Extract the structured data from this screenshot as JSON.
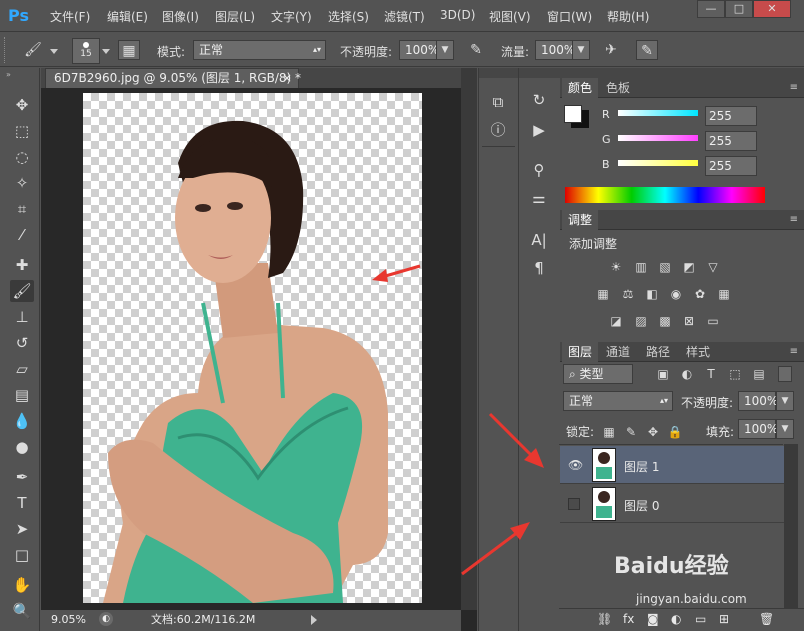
{
  "app": {
    "logo": "Ps"
  },
  "menu": [
    "文件(F)",
    "编辑(E)",
    "图像(I)",
    "图层(L)",
    "文字(Y)",
    "选择(S)",
    "滤镜(T)",
    "3D(D)",
    "视图(V)",
    "窗口(W)",
    "帮助(H)"
  ],
  "window_controls": {
    "minimize": "—",
    "maximize": "□",
    "close": "✕"
  },
  "options": {
    "brush_size": "15",
    "mode_label": "模式:",
    "mode_value": "正常",
    "opacity_label": "不透明度:",
    "opacity_value": "100%",
    "flow_label": "流量:",
    "flow_value": "100%"
  },
  "document": {
    "tab_title": "6D7B2960.jpg @ 9.05% (图层 1, RGB/8) *",
    "tab_close": "×",
    "zoom": "9.05%",
    "doc_size": "文档:60.2M/116.2M"
  },
  "color_panel": {
    "tabs": [
      "颜色",
      "色板"
    ],
    "channels": [
      {
        "label": "R",
        "value": "255",
        "color": "#00e6ff"
      },
      {
        "label": "G",
        "value": "255",
        "color": "#ff40ff"
      },
      {
        "label": "B",
        "value": "255",
        "color": "#ffff40"
      }
    ]
  },
  "adjustments_panel": {
    "tab": "调整",
    "title": "添加调整",
    "icons": [
      "brightness-icon",
      "levels-icon",
      "curves-icon",
      "exposure-icon",
      "vibrance-icon",
      "hue-saturation-icon",
      "color-balance-icon",
      "black-white-icon",
      "photo-filter-icon",
      "channel-mixer-icon",
      "color-lookup-icon",
      "invert-icon",
      "posterize-icon",
      "threshold-icon",
      "selective-color-icon",
      "gradient-map-icon"
    ]
  },
  "layers_panel": {
    "tabs": [
      "图层",
      "通道",
      "路径",
      "样式"
    ],
    "filter_kind": "类型",
    "blend_mode": "正常",
    "opacity_label": "不透明度:",
    "opacity_value": "100%",
    "lock_label": "锁定:",
    "fill_label": "填充:",
    "fill_value": "100%",
    "layers": [
      {
        "name": "图层 1",
        "visible": true,
        "selected": true
      },
      {
        "name": "图层 0",
        "visible": false,
        "selected": false
      }
    ]
  },
  "watermark": {
    "brand": "Baidu经验",
    "url": "jingyan.baidu.com"
  },
  "colors": {
    "accent": "#31a8ff",
    "selected_layer": "#596478",
    "arrow": "#e8372f"
  }
}
